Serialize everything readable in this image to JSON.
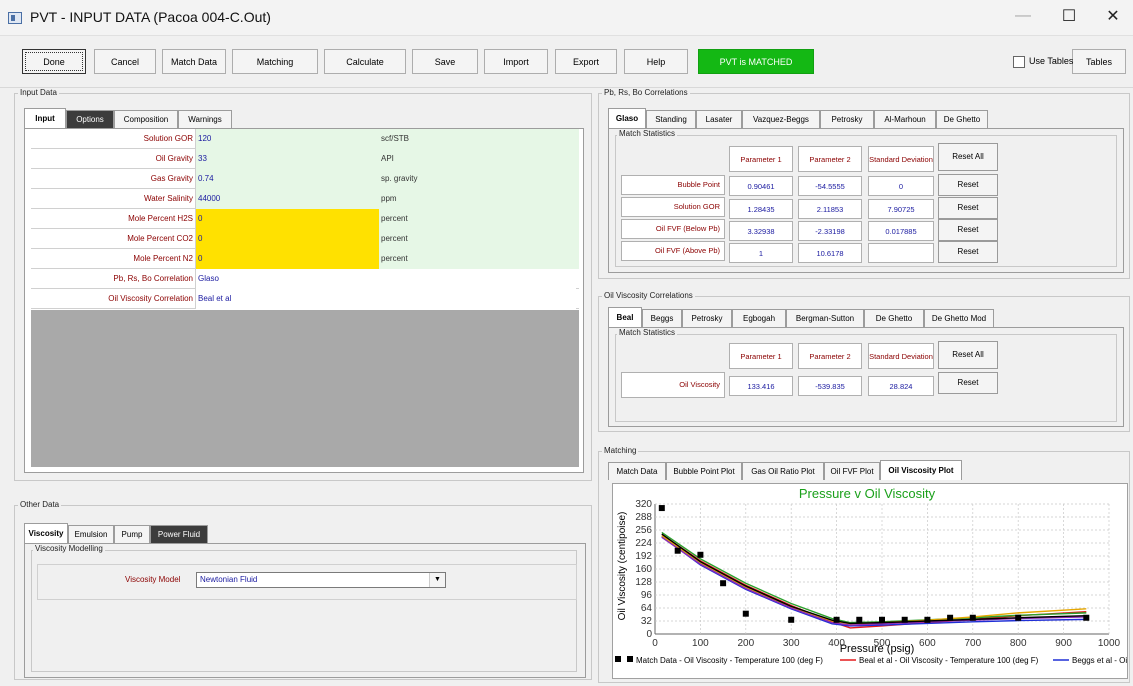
{
  "window": {
    "title": "PVT - INPUT DATA (Pacoa 004-C.Out)",
    "minimize": "—",
    "maximize": "☐",
    "close": "✕"
  },
  "toolbar": {
    "done": "Done",
    "cancel": "Cancel",
    "match_data": "Match Data",
    "matching": "Matching",
    "calculate": "Calculate",
    "save": "Save",
    "import": "Import",
    "export": "Export",
    "help": "Help",
    "status": "PVT is MATCHED",
    "use_tables": "Use Tables",
    "tables": "Tables"
  },
  "input_data": {
    "group_label": "Input Data",
    "tabs": [
      "Input",
      "Options",
      "Composition",
      "Warnings"
    ],
    "rows": [
      {
        "label": "Solution GOR",
        "value": "120",
        "unit": "scf/STB"
      },
      {
        "label": "Oil Gravity",
        "value": "33",
        "unit": "API"
      },
      {
        "label": "Gas Gravity",
        "value": "0.74",
        "unit": "sp. gravity"
      },
      {
        "label": "Water Salinity",
        "value": "44000",
        "unit": "ppm"
      },
      {
        "label": "Mole Percent H2S",
        "value": "0",
        "unit": "percent"
      },
      {
        "label": "Mole Percent CO2",
        "value": "0",
        "unit": "percent"
      },
      {
        "label": "Mole Percent N2",
        "value": "0",
        "unit": "percent"
      },
      {
        "label": "Pb, Rs, Bo Correlation",
        "value": "Glaso",
        "unit": ""
      },
      {
        "label": "Oil Viscosity Correlation",
        "value": "Beal et al",
        "unit": ""
      }
    ]
  },
  "other_data": {
    "group_label": "Other Data",
    "tabs": [
      "Viscosity",
      "Emulsion",
      "Pump",
      "Power Fluid"
    ],
    "sub_group": "Viscosity Modelling",
    "model_label": "Viscosity Model",
    "model_value": "Newtonian Fluid"
  },
  "pb_corr": {
    "group_label": "Pb, Rs, Bo Correlations",
    "tabs": [
      "Glaso",
      "Standing",
      "Lasater",
      "Vazquez-Beggs",
      "Petrosky",
      "Al-Marhoun",
      "De Ghetto"
    ],
    "sub_group": "Match Statistics",
    "headers": [
      "Parameter 1",
      "Parameter 2",
      "Standard Deviation"
    ],
    "reset_all": "Reset All",
    "reset": "Reset",
    "rows": [
      {
        "label": "Bubble Point",
        "p1": "0.90461",
        "p2": "-54.5555",
        "sd": "0"
      },
      {
        "label": "Solution GOR",
        "p1": "1.28435",
        "p2": "2.11853",
        "sd": "7.90725"
      },
      {
        "label": "Oil FVF (Below Pb)",
        "p1": "3.32938",
        "p2": "-2.33198",
        "sd": "0.017885"
      },
      {
        "label": "Oil FVF (Above Pb)",
        "p1": "1",
        "p2": "10.6178",
        "sd": ""
      }
    ]
  },
  "visc_corr": {
    "group_label": "Oil Viscosity Correlations",
    "tabs": [
      "Beal",
      "Beggs",
      "Petrosky",
      "Egbogah",
      "Bergman-Sutton",
      "De Ghetto",
      "De Ghetto Mod"
    ],
    "sub_group": "Match Statistics",
    "headers": [
      "Parameter 1",
      "Parameter 2",
      "Standard Deviation"
    ],
    "reset_all": "Reset All",
    "reset": "Reset",
    "row": {
      "label": "Oil Viscosity",
      "p1": "133.416",
      "p2": "-539.835",
      "sd": "28.824"
    }
  },
  "matching": {
    "group_label": "Matching",
    "tabs": [
      "Match Data",
      "Bubble Point Plot",
      "Gas Oil Ratio Plot",
      "Oil FVF Plot",
      "Oil Viscosity Plot"
    ]
  },
  "colors": {
    "matched": "#14b814",
    "title_green": "#1aa01a",
    "yellow": "#ffe100",
    "label_red": "#8b0000",
    "value_blue": "#1a1aa0"
  },
  "chart_data": {
    "type": "line",
    "title": "Pressure v Oil Viscosity",
    "xlabel": "Pressure  (psig)",
    "ylabel": "Oil Viscosity  (centipoise)",
    "xlim": [
      0,
      1000
    ],
    "ylim": [
      0,
      320
    ],
    "xticks": [
      0,
      100,
      200,
      300,
      400,
      500,
      600,
      700,
      800,
      900,
      1000
    ],
    "yticks": [
      0,
      32,
      64,
      96,
      128,
      160,
      192,
      224,
      256,
      288,
      320
    ],
    "grid": true,
    "legend": [
      "Match Data - Oil Viscosity - Temperature 100 (deg F)",
      "Beal et al - Oil Viscosity - Temperature 100 (deg F)",
      "Beggs et al - Oi"
    ],
    "match_points": {
      "x": [
        15,
        50,
        100,
        150,
        200,
        300,
        400,
        450,
        500,
        550,
        600,
        650,
        700,
        800,
        950
      ],
      "y": [
        310,
        205,
        195,
        125,
        50,
        35,
        35,
        35,
        35,
        35,
        35,
        40,
        40,
        40,
        40
      ]
    },
    "series": [
      {
        "color": "#e41a1c",
        "x": [
          15,
          100,
          200,
          300,
          390,
          430,
          500,
          600,
          700,
          800,
          950
        ],
        "y": [
          245,
          180,
          120,
          70,
          30,
          15,
          20,
          28,
          36,
          45,
          55
        ]
      },
      {
        "color": "#1f2fd6",
        "x": [
          15,
          100,
          200,
          300,
          390,
          430,
          500,
          600,
          700,
          800,
          950
        ],
        "y": [
          240,
          170,
          110,
          62,
          25,
          20,
          22,
          26,
          30,
          33,
          36
        ]
      },
      {
        "color": "#2ca02c",
        "x": [
          15,
          100,
          200,
          300,
          390,
          430,
          500,
          600,
          700,
          800,
          950
        ],
        "y": [
          250,
          185,
          125,
          75,
          38,
          28,
          30,
          35,
          40,
          46,
          52
        ]
      },
      {
        "color": "#e6a700",
        "x": [
          15,
          100,
          200,
          300,
          390,
          430,
          500,
          600,
          700,
          800,
          950
        ],
        "y": [
          242,
          175,
          115,
          66,
          32,
          25,
          28,
          34,
          42,
          52,
          62
        ]
      },
      {
        "color": "#8e2bb5",
        "x": [
          15,
          100,
          200,
          300,
          390,
          430,
          500,
          600,
          700,
          800,
          950
        ],
        "y": [
          238,
          172,
          112,
          64,
          28,
          22,
          25,
          30,
          34,
          38,
          42
        ]
      },
      {
        "color": "#000000",
        "x": [
          15,
          100,
          200,
          300,
          390,
          430,
          500,
          600,
          700,
          800,
          950
        ],
        "y": [
          246,
          178,
          118,
          68,
          34,
          26,
          28,
          32,
          36,
          40,
          45
        ]
      }
    ]
  }
}
